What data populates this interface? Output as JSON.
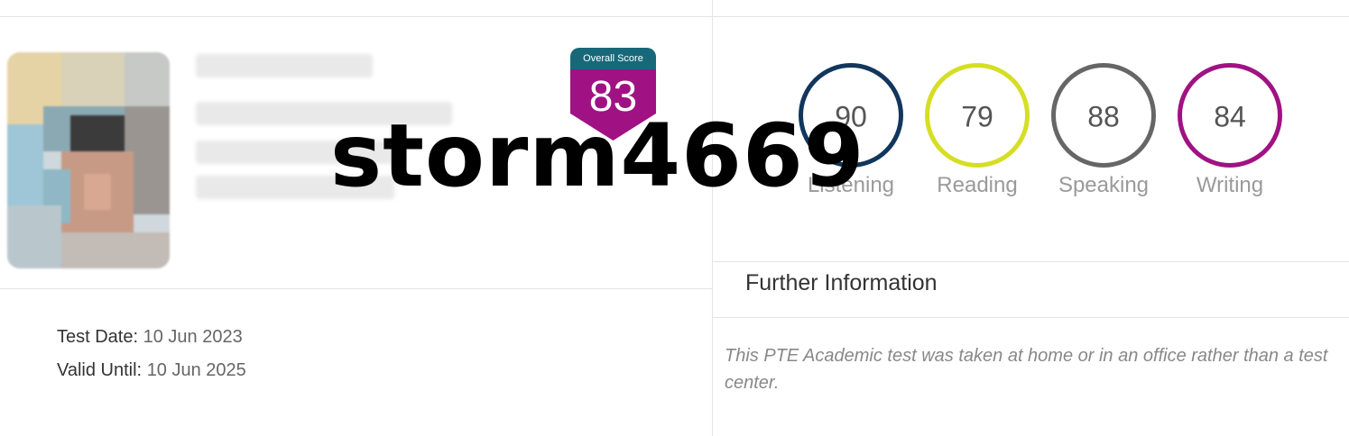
{
  "overall": {
    "caption": "Overall Score",
    "value": "83",
    "cap_color": "#17697a",
    "shield_color": "#a01283"
  },
  "watermark": "storm4669",
  "skills": [
    {
      "name": "Listening",
      "score": "90",
      "color": "#12365c"
    },
    {
      "name": "Reading",
      "score": "79",
      "color": "#d6de24"
    },
    {
      "name": "Speaking",
      "score": "88",
      "color": "#666666"
    },
    {
      "name": "Writing",
      "score": "84",
      "color": "#a01283"
    }
  ],
  "further": {
    "title": "Further Information",
    "text": "This PTE Academic test was taken at home or in an office rather than a test center."
  },
  "test_date": {
    "label": "Test Date:",
    "value": "10 Jun 2023"
  },
  "valid_until": {
    "label": "Valid Until:",
    "value": "10 Jun 2025"
  }
}
